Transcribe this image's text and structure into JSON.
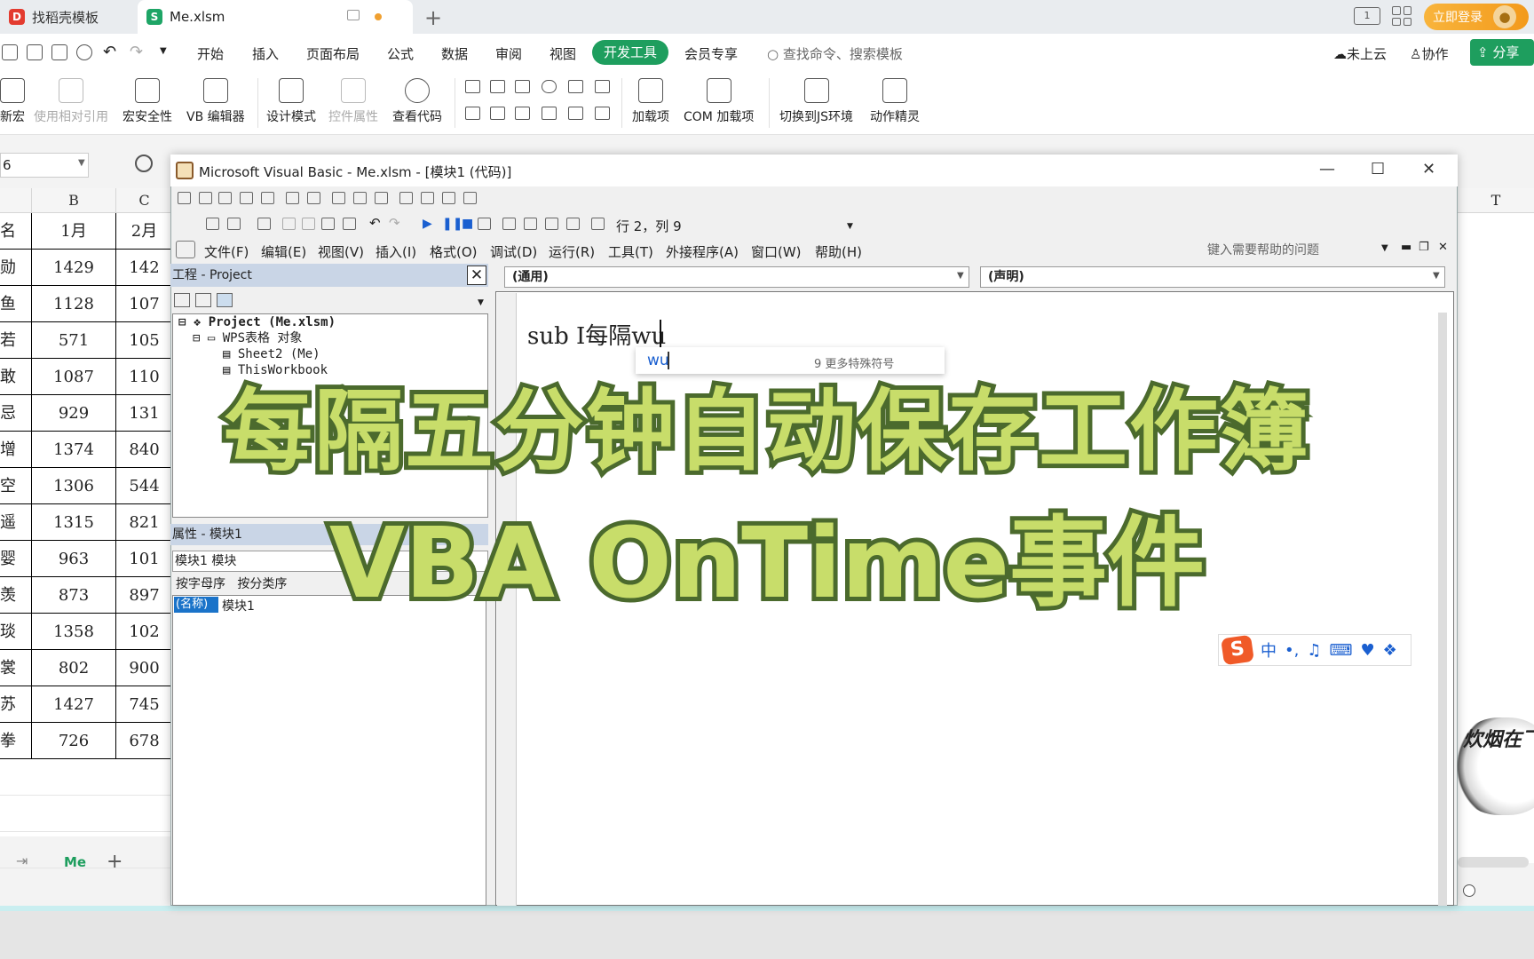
{
  "tabs": {
    "template": "找稻壳模板",
    "file": "Me.xlsm",
    "login": "立即登录",
    "layout_icon": "1"
  },
  "menu": {
    "items": [
      "开始",
      "插入",
      "页面布局",
      "公式",
      "数据",
      "审阅",
      "视图",
      "开发工具",
      "会员专享"
    ],
    "search": "查找命令、搜索模板",
    "cloud": "未上云",
    "collab": "协作",
    "share": "分享"
  },
  "ribbon": {
    "macro": "新宏",
    "relative_ref": "使用相对引用",
    "macro_security": "宏安全性",
    "vb_editor": "VB 编辑器",
    "design_mode": "设计模式",
    "control_props": "控件属性",
    "view_code": "查看代码",
    "addins": "加载项",
    "com_addins": "COM 加载项",
    "js_env": "切换到JS环境",
    "action_wizard": "动作精灵"
  },
  "sheet": {
    "namebox": "6",
    "col_b": "B",
    "col_c": "C",
    "col_t": "T",
    "rows": [
      {
        "name": "名",
        "b": "1月",
        "c": "2月"
      },
      {
        "name": "勋",
        "b": "1429",
        "c": "142"
      },
      {
        "name": "鱼",
        "b": "1128",
        "c": "107"
      },
      {
        "name": "若",
        "b": "571",
        "c": "105"
      },
      {
        "name": "敢",
        "b": "1087",
        "c": "110"
      },
      {
        "name": "忌",
        "b": "929",
        "c": "131"
      },
      {
        "name": "增",
        "b": "1374",
        "c": "840"
      },
      {
        "name": "空",
        "b": "1306",
        "c": "544"
      },
      {
        "name": "遥",
        "b": "1315",
        "c": "821"
      },
      {
        "name": "婴",
        "b": "963",
        "c": "101"
      },
      {
        "name": "羡",
        "b": "873",
        "c": "897"
      },
      {
        "name": "琰",
        "b": "1358",
        "c": "102"
      },
      {
        "name": "裳",
        "b": "802",
        "c": "900"
      },
      {
        "name": "苏",
        "b": "1427",
        "c": "745"
      },
      {
        "name": "拳",
        "b": "726",
        "c": "678"
      }
    ],
    "tab_name": "Me"
  },
  "vba": {
    "title": "Microsoft Visual Basic - Me.xlsm - [模块1 (代码)]",
    "rowcol": "行 2，列 9",
    "menus": [
      "文件(F)",
      "编辑(E)",
      "视图(V)",
      "插入(I)",
      "格式(O)",
      "调试(D)",
      "运行(R)",
      "工具(T)",
      "外接程序(A)",
      "窗口(W)",
      "帮助(H)"
    ],
    "help_placeholder": "键入需要帮助的问题",
    "project_title": "工程 - Project",
    "tree": [
      "Project (Me.xlsm)",
      "WPS表格 对象",
      "Sheet2 (Me)",
      "ThisWorkbook"
    ],
    "props_title": "属性 - 模块1",
    "props_combo": "模块1 模块",
    "props_tab_alpha": "按字母序",
    "props_tab_cat": "按分类序",
    "prop_key": "(名称)",
    "prop_val": "模块1",
    "combo_general": "(通用)",
    "combo_decl": "(声明)",
    "code_text": "sub I每隔wu",
    "ime_input": "wu",
    "ime_more": "9 更多特殊符号",
    "ime_cn": "中"
  },
  "overlay": {
    "line1": "每隔五分钟自动保存工作簿",
    "line2": "VBA OnTime事件"
  },
  "seal": {
    "text": "炊烟在飞"
  }
}
